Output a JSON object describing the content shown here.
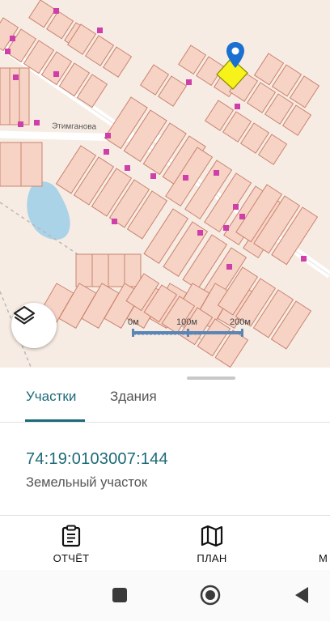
{
  "map": {
    "street_name": "Этимганова",
    "scale_labels": [
      "0м",
      "100м",
      "200м"
    ],
    "colors": {
      "background": "#f7ece3",
      "parcel_fill": "#f7d3c6",
      "parcel_border": "#c9836e",
      "building": "#cf3fa9",
      "water": "#aad3e8",
      "selected_parcel": "#f7f21a",
      "marker": "#1a6fd0"
    },
    "icons": {
      "layers": "layers-icon",
      "marker": "location-pin-icon"
    }
  },
  "sheet": {
    "tabs": [
      {
        "label": "Участки",
        "active": true
      },
      {
        "label": "Здания",
        "active": false
      }
    ],
    "cadastral_number": "74:19:0103007:144",
    "object_type": "Земельный участок",
    "accent_color": "#1c6a78"
  },
  "actions": [
    {
      "label": "ОТЧЁТ",
      "icon": "clipboard-icon"
    },
    {
      "label": "ПЛАН",
      "icon": "map-icon"
    },
    {
      "label": "М",
      "icon": "more-icon"
    }
  ],
  "navbar": {
    "buttons": [
      "recents-square-icon",
      "home-circle-icon",
      "back-triangle-icon"
    ]
  }
}
